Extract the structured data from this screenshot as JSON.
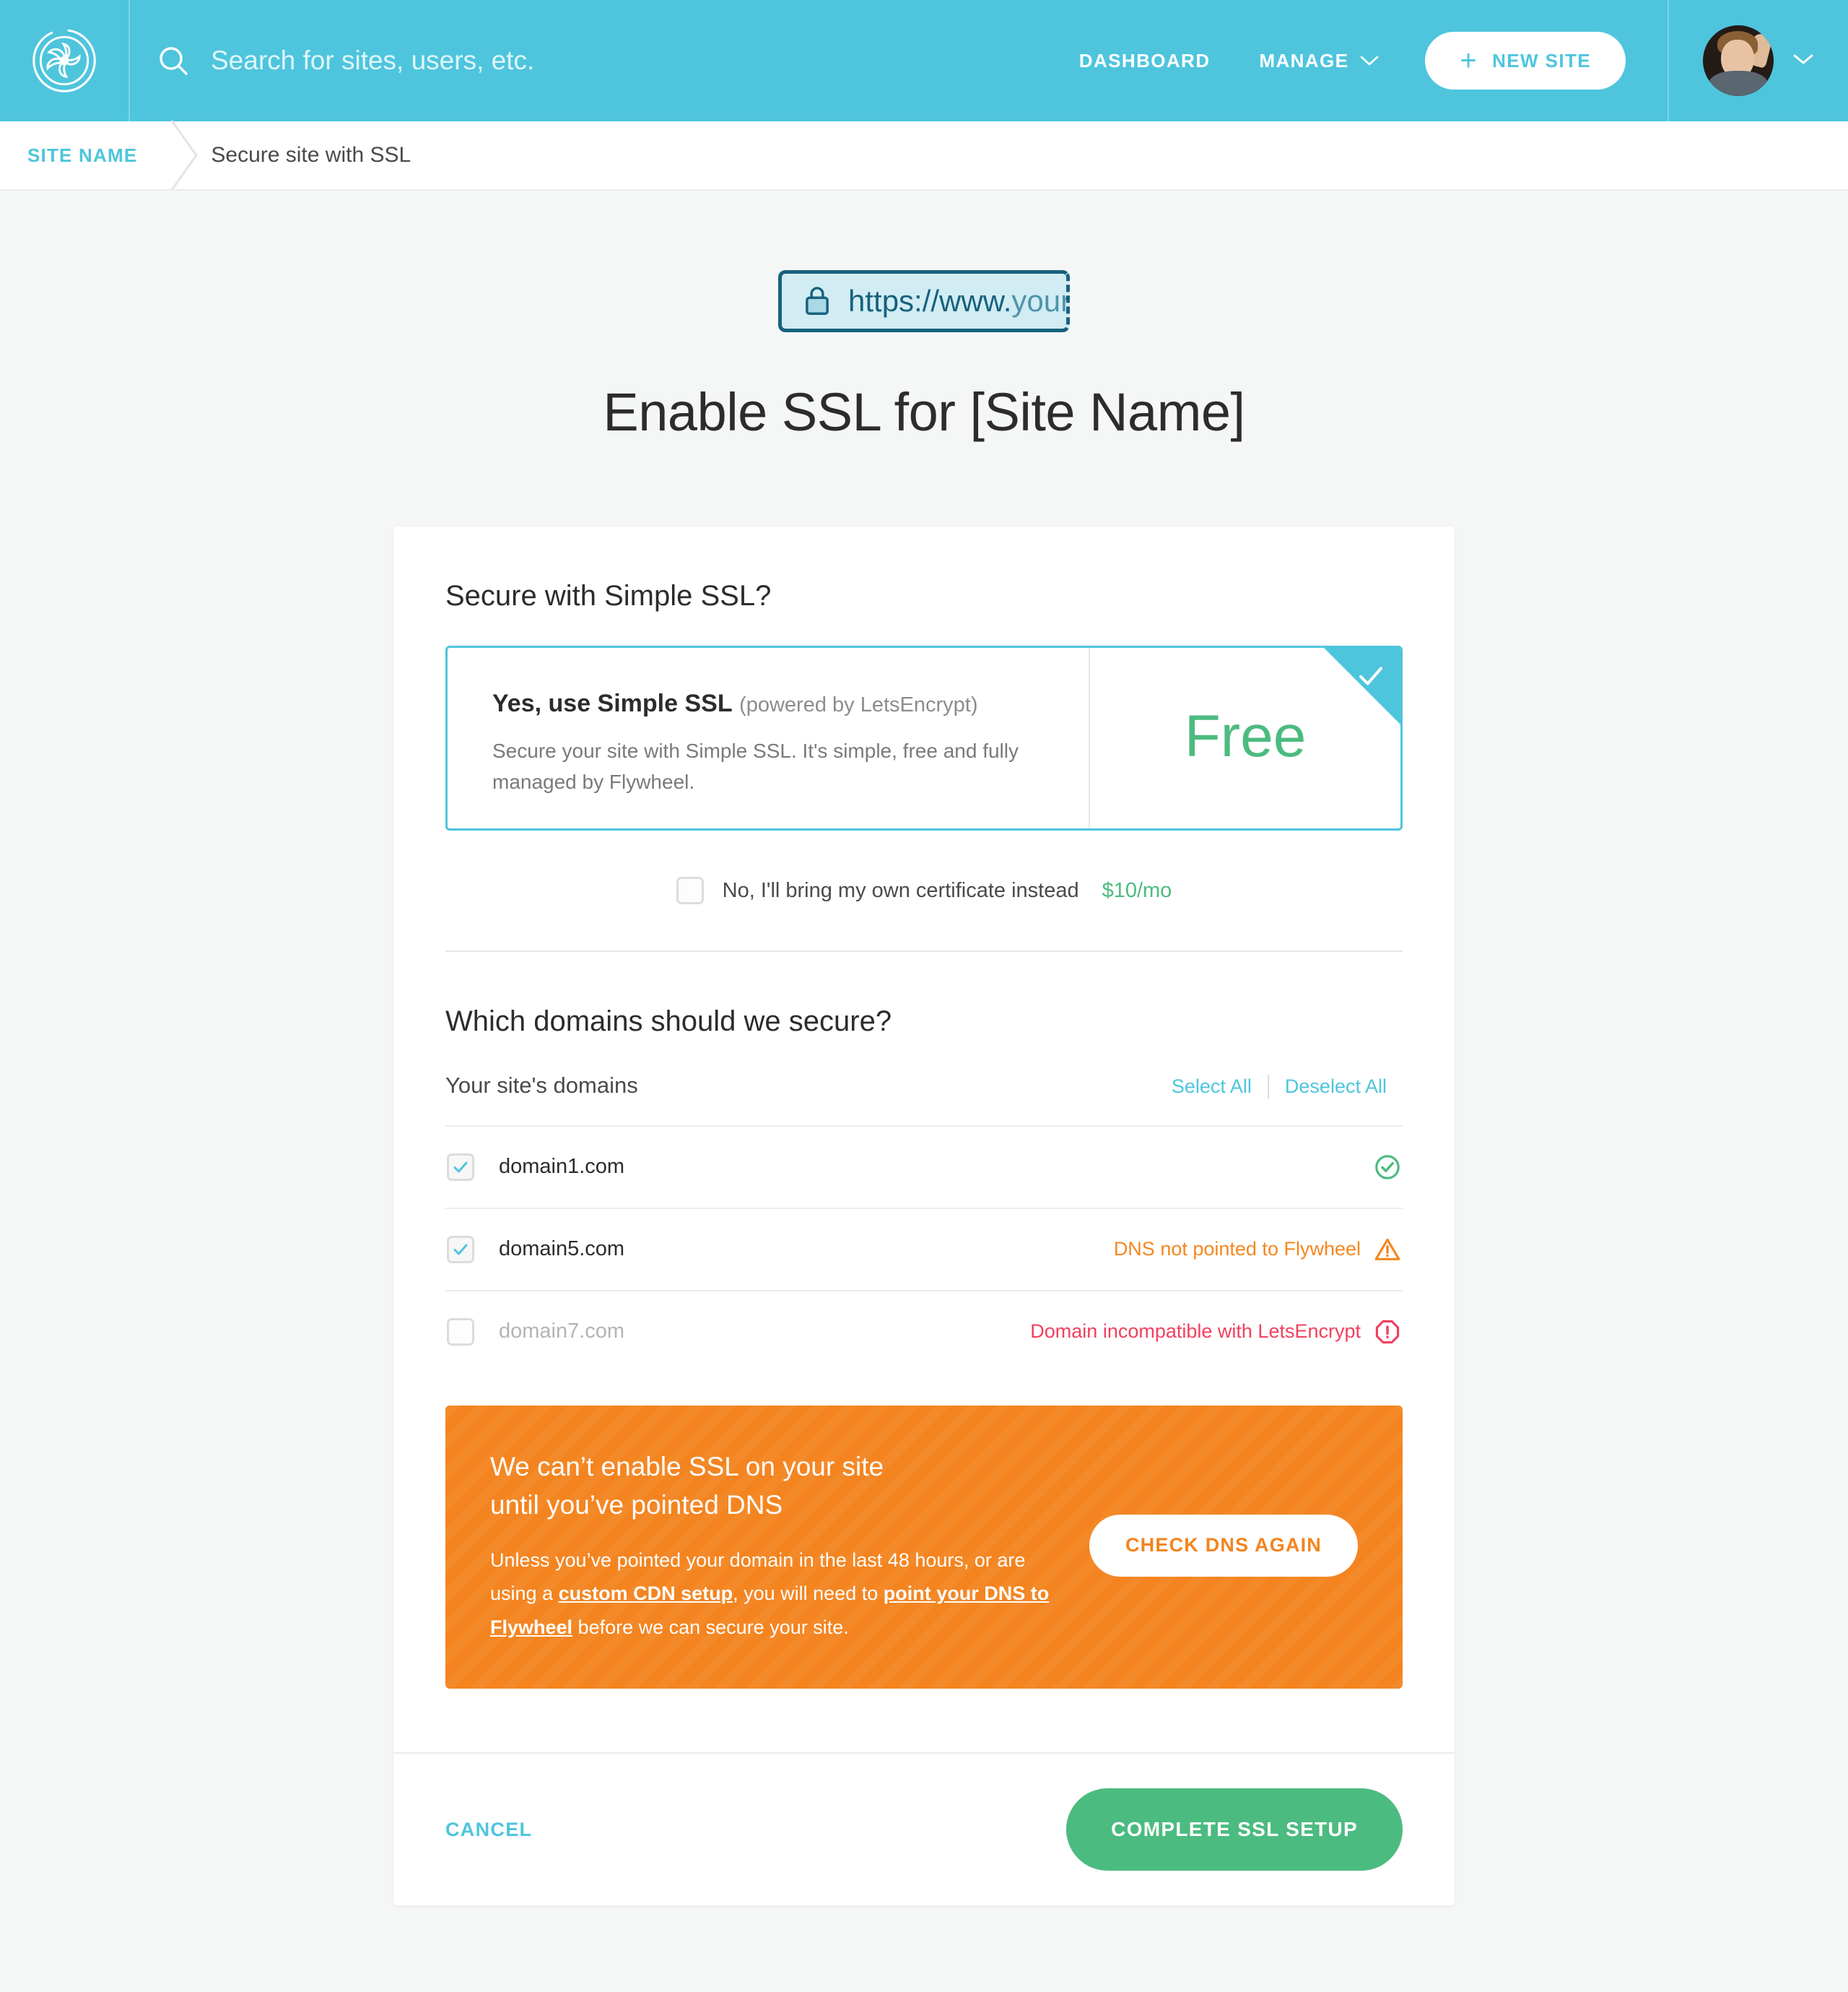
{
  "nav": {
    "logo_icon": "flywheel-logo-icon",
    "search": {
      "icon": "search-icon",
      "placeholder": "Search for sites, users, etc.",
      "value": ""
    },
    "links": [
      {
        "label": "DASHBOARD",
        "icon": null
      },
      {
        "label": "MANAGE",
        "icon": "chevron-down-icon"
      }
    ],
    "new_site_button": {
      "label": "NEW SITE",
      "icon": "plus-icon"
    },
    "account": {
      "avatar": "user-avatar",
      "caret": "chevron-down-icon"
    },
    "background_color": "#4ec5dd"
  },
  "breadcrumb": {
    "site": "SITE NAME",
    "separator_icon": "chevron-right-icon",
    "current": "Secure site with SSL"
  },
  "hero": {
    "url_pill": {
      "lock_icon": "lock-icon",
      "url_strong": "https://www.",
      "url_faded": "yoursit",
      "truncated": true
    },
    "title": "Enable SSL for [Site Name]"
  },
  "card": {
    "simple_ssl": {
      "section_title": "Secure with Simple SSL?",
      "option": {
        "selected": true,
        "selected_icon": "check-icon",
        "heading_bold": "Yes, use Simple SSL",
        "heading_light": "(powered by LetsEncrypt)",
        "description": "Secure your site with Simple SSL. It's simple, free and fully managed by Flywheel.",
        "price": "Free",
        "price_color": "#4cbb80"
      },
      "own_certificate": {
        "checked": false,
        "label": "No, I'll bring my own certificate instead",
        "price": "$10/mo",
        "price_color": "#4cbb80"
      }
    },
    "domains": {
      "section_title": "Which domains should we secure?",
      "subhead": "Your site's domains",
      "select_all": "Select All",
      "deselect_all": "Deselect All",
      "rows": [
        {
          "name": "domain1.com",
          "checked": true,
          "enabled": true,
          "status_text": "",
          "status_icon": "check-circle-icon",
          "status_kind": "ok",
          "status_color": "#4cbb80"
        },
        {
          "name": "domain5.com",
          "checked": true,
          "enabled": true,
          "status_text": "DNS not pointed to Flywheel",
          "status_icon": "warning-triangle-icon",
          "status_kind": "warn",
          "status_color": "#f4871f"
        },
        {
          "name": "domain7.com",
          "checked": false,
          "enabled": false,
          "status_text": "Domain incompatible with LetsEncrypt",
          "status_icon": "error-octagon-icon",
          "status_kind": "err",
          "status_color": "#f2405d"
        }
      ]
    },
    "alert": {
      "background_color": "#f4841f",
      "title_line1": "We can’t enable SSL on your site",
      "title_line2": "until you’ve pointed DNS",
      "body_part1": "Unless you’ve pointed your domain in the last 48 hours, or are using a ",
      "body_link1": "custom CDN setup",
      "body_part2": ", you will need to ",
      "body_link2": "point your DNS to Flywheel",
      "body_part3": " before we can secure your site.",
      "button": "CHECK DNS AGAIN"
    },
    "footer": {
      "cancel": "CANCEL",
      "complete": "COMPLETE SSL SETUP",
      "complete_color": "#4cbb80"
    }
  }
}
